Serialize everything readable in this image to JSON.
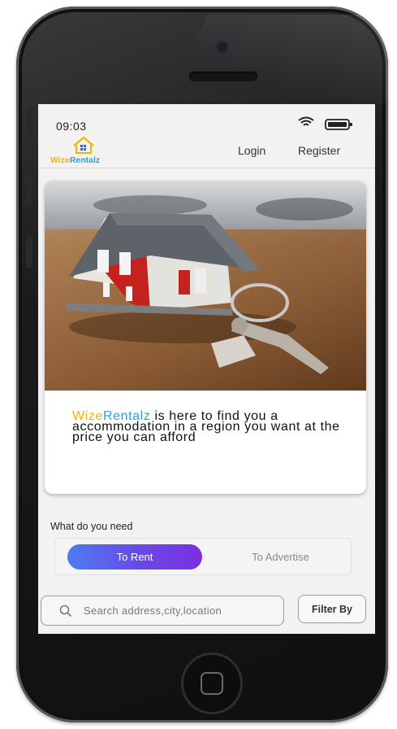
{
  "status_bar": {
    "time": "09:03",
    "wifi_icon": "wifi-icon",
    "battery_icon": "battery-icon"
  },
  "header": {
    "logo": {
      "brand_part1": "Wize",
      "brand_part2": "Rentalz",
      "icon": "house-logo-icon"
    },
    "nav": {
      "login": "Login",
      "register": "Register"
    }
  },
  "hero": {
    "image": "house-model-with-keys-photo",
    "tagline": {
      "brand_part1": "Wize",
      "brand_part2": "Rentalz",
      "text": " is here to find you a accommodation in a region you want at the price you can afford"
    }
  },
  "need": {
    "label": "What do you need",
    "options": [
      {
        "label": "To Rent",
        "selected": true
      },
      {
        "label": "To Advertise",
        "selected": false
      }
    ]
  },
  "search": {
    "placeholder": "Search address,city,location",
    "value": "",
    "icon": "search-icon"
  },
  "filter": {
    "label": "Filter By"
  },
  "colors": {
    "brand_yellow": "#f1b400",
    "brand_blue": "#2fa0e0",
    "toggle_gradient_start": "#4d7cf0",
    "toggle_gradient_end": "#7b2fe0"
  }
}
